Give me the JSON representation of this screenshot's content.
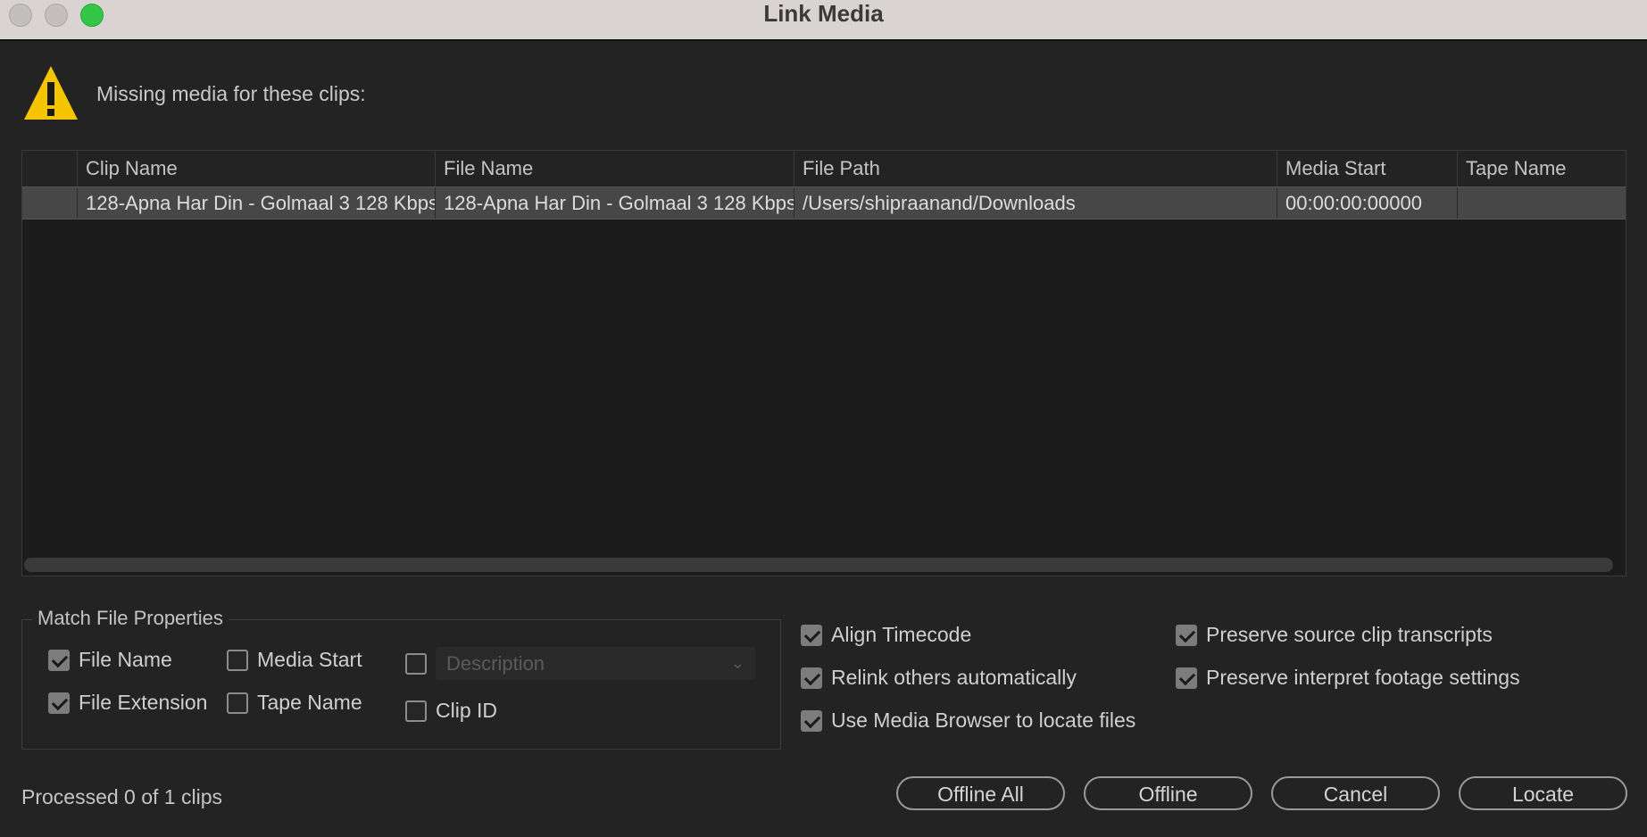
{
  "window": {
    "title": "Link Media"
  },
  "header": {
    "message": "Missing media for these clips:"
  },
  "table": {
    "columns": [
      "Clip Name",
      "File Name",
      "File Path",
      "Media Start",
      "Tape Name"
    ],
    "rows": [
      {
        "clip_name": "128-Apna Har Din - Golmaal 3 128 Kbps",
        "file_name": "128-Apna Har Din - Golmaal 3 128 Kbps",
        "file_path": "/Users/shipraanand/Downloads",
        "media_start": "00:00:00:00000",
        "tape_name": ""
      }
    ]
  },
  "match_props": {
    "legend": "Match File Properties",
    "file_name": {
      "label": "File Name",
      "checked": true
    },
    "media_start": {
      "label": "Media Start",
      "checked": false
    },
    "description": {
      "label": "Description",
      "checked": false
    },
    "file_extension": {
      "label": "File Extension",
      "checked": true
    },
    "tape_name": {
      "label": "Tape Name",
      "checked": false
    },
    "clip_id": {
      "label": "Clip ID",
      "checked": false
    }
  },
  "options": {
    "align_timecode": {
      "label": "Align Timecode",
      "checked": true
    },
    "relink_others": {
      "label": "Relink others automatically",
      "checked": true
    },
    "use_media_browser": {
      "label": "Use Media Browser to locate files",
      "checked": true
    },
    "preserve_transcripts": {
      "label": "Preserve source clip transcripts",
      "checked": true
    },
    "preserve_interpret": {
      "label": "Preserve interpret footage settings",
      "checked": true
    }
  },
  "status": "Processed 0 of 1 clips",
  "buttons": {
    "offline_all": "Offline All",
    "offline": "Offline",
    "cancel": "Cancel",
    "locate": "Locate"
  },
  "colors": {
    "background": "#232323",
    "warning": "#f5c400",
    "zoom_button": "#33c748"
  }
}
